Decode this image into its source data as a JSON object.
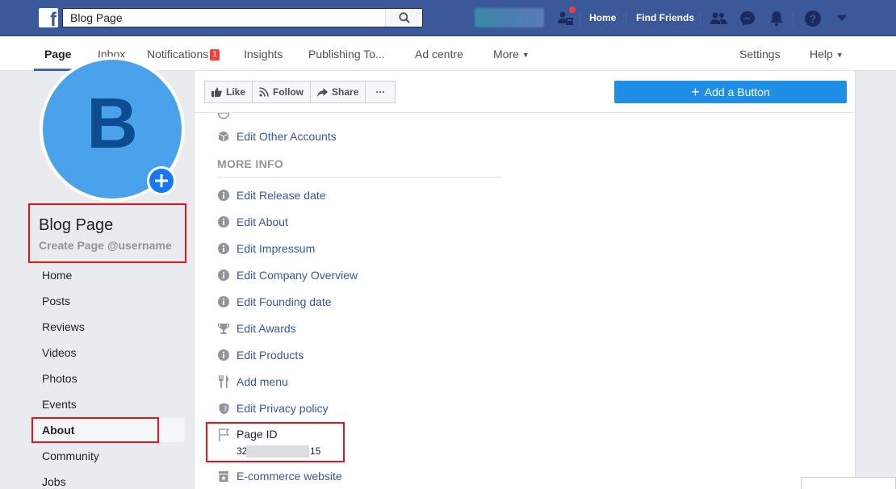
{
  "topbar": {
    "search_value": "Blog Page",
    "links": {
      "home": "Home",
      "find_friends": "Find Friends"
    }
  },
  "nav": {
    "page": "Page",
    "inbox": "Inbox",
    "notifications": "Notifications",
    "notifications_count": "1",
    "insights": "Insights",
    "publishing": "Publishing To...",
    "ad_centre": "Ad centre",
    "more": "More",
    "settings": "Settings",
    "help": "Help"
  },
  "profile": {
    "initial": "B",
    "name": "Blog Page",
    "username_prompt": "Create Page @username"
  },
  "sidebar": {
    "items": [
      "Home",
      "Posts",
      "Reviews",
      "Videos",
      "Photos",
      "Events",
      "About",
      "Community",
      "Jobs"
    ],
    "active": "About"
  },
  "actions": {
    "like": "Like",
    "follow": "Follow",
    "share": "Share",
    "more": "···",
    "add_button": "Add a Button"
  },
  "info": {
    "edit_other_accounts": "Edit Other Accounts",
    "more_info_heading": "MORE INFO",
    "items": [
      {
        "label": "Edit Release date",
        "icon": "info-icon"
      },
      {
        "label": "Edit About",
        "icon": "info-icon"
      },
      {
        "label": "Edit Impressum",
        "icon": "info-icon"
      },
      {
        "label": "Edit Company Overview",
        "icon": "info-icon"
      },
      {
        "label": "Edit Founding date",
        "icon": "info-icon"
      },
      {
        "label": "Edit Awards",
        "icon": "trophy-icon"
      },
      {
        "label": "Edit Products",
        "icon": "info-icon"
      },
      {
        "label": "Add menu",
        "icon": "fork-knife-icon"
      },
      {
        "label": "Edit Privacy policy",
        "icon": "shield-icon"
      }
    ],
    "page_id_label": "Page ID",
    "page_id_prefix": "32",
    "page_id_suffix": "15",
    "ecommerce": "E-commerce website"
  },
  "colors": {
    "topbar": "#3b5998",
    "link": "#365899",
    "accent_button": "#1e8ee6",
    "highlight_box": "#e8131b"
  }
}
